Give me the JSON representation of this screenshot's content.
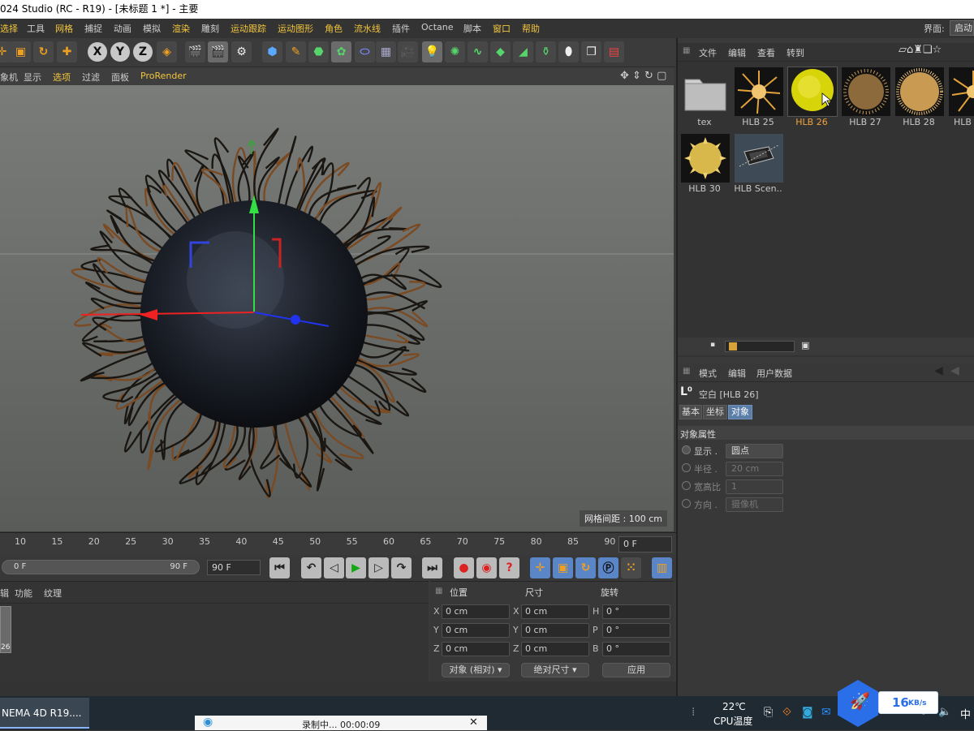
{
  "window": {
    "title": "024 Studio (RC - R19) - [未标题 1 *] - 主要"
  },
  "menu": {
    "items": [
      "选择",
      "工具",
      "网格",
      "捕捉",
      "动画",
      "模拟",
      "渲染",
      "雕刻",
      "运动跟踪",
      "运动图形",
      "角色",
      "流水线",
      "插件",
      "Octane",
      "脚本",
      "窗口",
      "帮助"
    ],
    "layout_label": "界面:",
    "layout_value": "启动"
  },
  "viewport_menu": {
    "items": [
      "象机",
      "显示",
      "选项",
      "过滤",
      "面板",
      "ProRender"
    ]
  },
  "viewport": {
    "grid_spacing": "网格间距 : 100 cm"
  },
  "timeline": {
    "ticks": [
      "10",
      "15",
      "20",
      "25",
      "30",
      "35",
      "40",
      "45",
      "50",
      "55",
      "60",
      "65",
      "70",
      "75",
      "80",
      "85",
      "90"
    ],
    "current_frame": "0 F",
    "range_start": "0 F",
    "range_end": "90 F",
    "max_frame": "90 F"
  },
  "material_manager": {
    "tabs": [
      "辑",
      "功能",
      "纹理"
    ],
    "material_label": "26"
  },
  "coordinates": {
    "headers": [
      "位置",
      "尺寸",
      "旋转"
    ],
    "rows": [
      {
        "axis1": "X",
        "pos": "0 cm",
        "axis2": "X",
        "size": "0 cm",
        "axis3": "H",
        "rot": "0 °"
      },
      {
        "axis1": "Y",
        "pos": "0 cm",
        "axis2": "Y",
        "size": "0 cm",
        "axis3": "P",
        "rot": "0 °"
      },
      {
        "axis1": "Z",
        "pos": "0 cm",
        "axis2": "Z",
        "size": "0 cm",
        "axis3": "B",
        "rot": "0 °"
      }
    ],
    "mode": "对象 (相对)",
    "size_mode": "绝对尺寸",
    "apply": "应用"
  },
  "content_browser": {
    "menu": [
      "文件",
      "编辑",
      "查看",
      "转到"
    ],
    "items": [
      {
        "label": "tex",
        "selected": false
      },
      {
        "label": "HLB 25",
        "selected": false
      },
      {
        "label": "HLB 26",
        "selected": true
      },
      {
        "label": "HLB 27",
        "selected": false
      },
      {
        "label": "HLB 28",
        "selected": false
      },
      {
        "label": "HLB",
        "selected": false
      },
      {
        "label": "HLB 30",
        "selected": false
      },
      {
        "label": "HLB Scen..",
        "selected": false
      }
    ]
  },
  "attributes": {
    "menu": [
      "模式",
      "编辑",
      "用户数据"
    ],
    "object_name": "空白 [HLB 26]",
    "tabs": [
      "基本",
      "坐标",
      "对象"
    ],
    "section": "对象属性",
    "props": [
      {
        "label": "显示 .",
        "value": "圆点"
      },
      {
        "label": "半径 .",
        "value": "20 cm"
      },
      {
        "label": "宽高比",
        "value": "1"
      },
      {
        "label": "方向 .",
        "value": "摄像机"
      }
    ]
  },
  "taskbar": {
    "app": "NEMA 4D R19....",
    "recording": "录制中... 00:00:09",
    "temperature": "22℃",
    "temp_label": "CPU温度",
    "net_speed": "16",
    "net_unit": "KB/s",
    "ime": "中"
  }
}
